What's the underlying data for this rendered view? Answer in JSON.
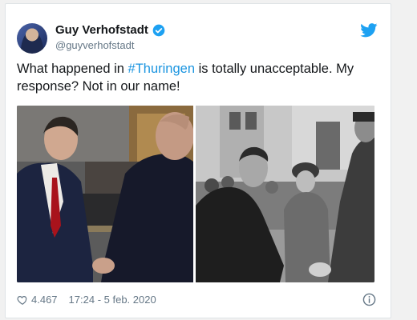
{
  "tweet": {
    "author_name": "Guy Verhofstadt",
    "author_handle": "@guyverhofstadt",
    "text_before": "What happened in ",
    "hashtag": "#Thuringen",
    "text_after": " is totally unacceptable. My response? Not in our name!",
    "likes": "4.467",
    "timestamp": "17:24 - 5 feb. 2020"
  },
  "icons": {
    "verified": "verified-badge-icon",
    "bird": "twitter-bird-icon",
    "like": "heart-icon",
    "info": "info-icon"
  },
  "colors": {
    "verified": "#1da1f2",
    "hashtag": "#1b95e0",
    "muted": "#657786"
  }
}
